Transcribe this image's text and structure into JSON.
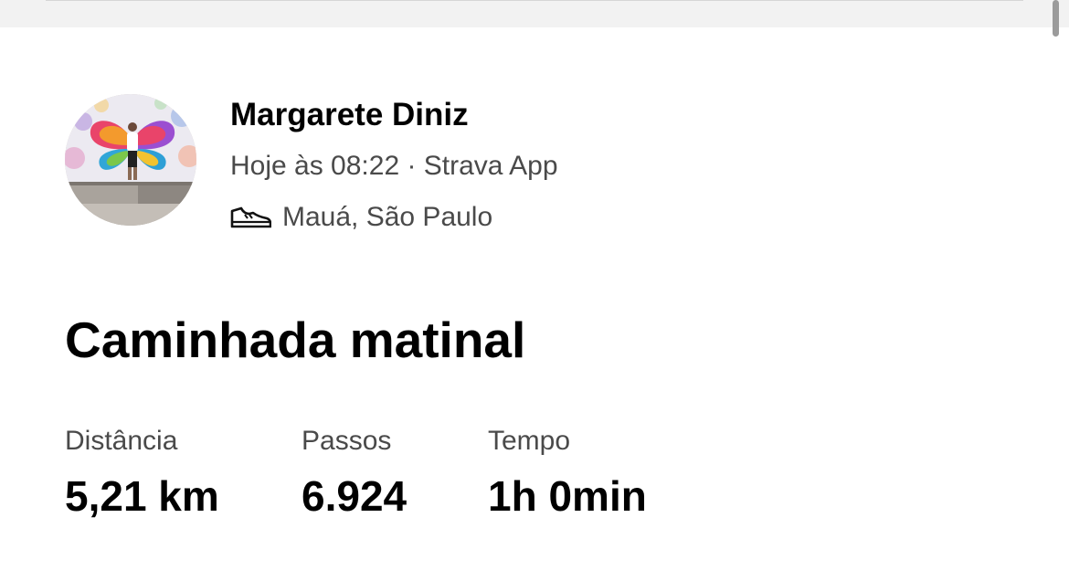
{
  "athlete": {
    "name": "Margarete Diniz",
    "meta": "Hoje às 08:22 · Strava App",
    "activity_icon": "shoe-icon",
    "location": "Mauá, São Paulo"
  },
  "activity": {
    "title": "Caminhada matinal"
  },
  "stats": [
    {
      "label": "Distância",
      "value": "5,21 km"
    },
    {
      "label": "Passos",
      "value": "6.924"
    },
    {
      "label": "Tempo",
      "value": "1h 0min"
    }
  ],
  "colors": {
    "text_primary": "#000000",
    "text_secondary": "#4a4a4a",
    "top_strip": "#f2f2f2"
  }
}
